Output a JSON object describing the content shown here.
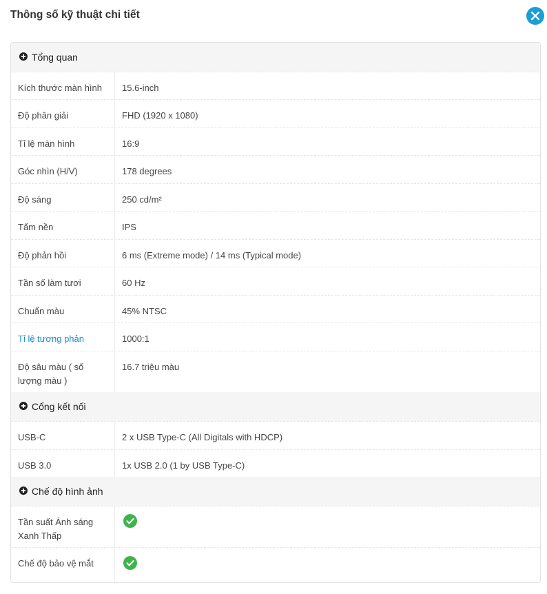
{
  "dialog": {
    "title": "Thông số kỹ thuật chi tiết",
    "close_icon": "close-icon"
  },
  "sections": [
    {
      "title": "Tổng quan",
      "rows": [
        {
          "label": "Kích thước màn hình",
          "value": "15.6-inch"
        },
        {
          "label": "Độ phân giải",
          "value": "FHD (1920 x 1080)"
        },
        {
          "label": "Tỉ lệ màn hình",
          "value": "16:9"
        },
        {
          "label": "Góc nhìn (H/V)",
          "value": "178 degrees"
        },
        {
          "label": "Độ sáng",
          "value": "250 cd/m²"
        },
        {
          "label": "Tấm nền",
          "value": "IPS"
        },
        {
          "label": "Độ phản hồi",
          "value": "6 ms (Extreme mode) / 14 ms (Typical mode)"
        },
        {
          "label": "Tần số làm tươi",
          "value": "60 Hz"
        },
        {
          "label": "Chuẩn màu",
          "value": "45% NTSC"
        },
        {
          "label": "Tỉ lệ tương phản",
          "value": "1000:1",
          "is_link": true
        },
        {
          "label": "Độ sâu màu ( số lượng màu )",
          "value": "16.7 triệu màu"
        }
      ]
    },
    {
      "title": "Cổng kết nối",
      "rows": [
        {
          "label": "USB-C",
          "value": "2 x USB Type-C (All Digitals with HDCP)"
        },
        {
          "label": "USB 3.0",
          "value": "1x USB 2.0 (1 by USB Type-C)"
        }
      ]
    },
    {
      "title": "Chế độ hình ảnh",
      "rows": [
        {
          "label": "Tần suất Ánh sáng Xanh Thấp",
          "value_icon": "check-circle-icon"
        },
        {
          "label": "Chế độ bảo vệ mắt",
          "value_icon": "check-circle-icon"
        }
      ]
    }
  ],
  "colors": {
    "accent": "#1a9ed8",
    "link": "#1a8ad0",
    "check": "#3fb44d",
    "section_bg": "#f5f5f5"
  }
}
